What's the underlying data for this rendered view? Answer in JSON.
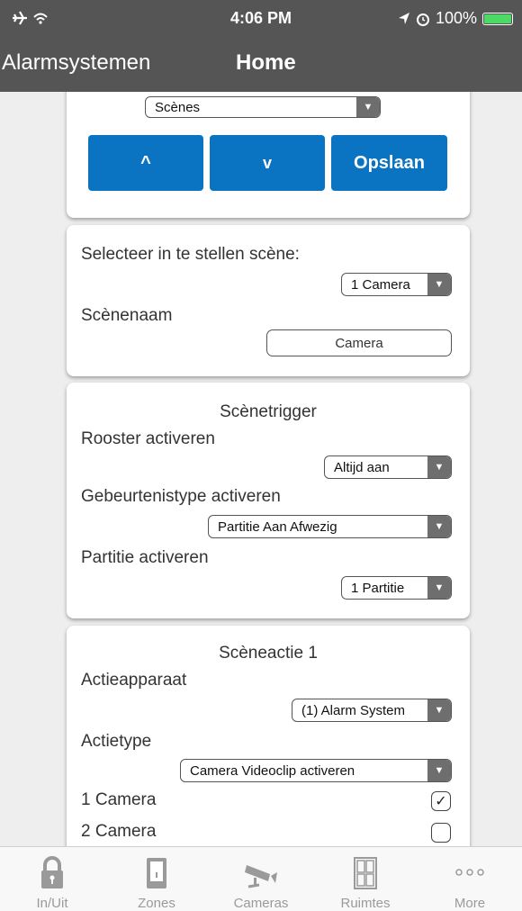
{
  "status_bar": {
    "time": "4:06 PM",
    "battery": "100%",
    "left_icons": "airplane-wifi",
    "right_icons": "location-alarm"
  },
  "nav": {
    "back_label": "Alarmsystemen",
    "title": "Home"
  },
  "top_card": {
    "dropdown_value": "Scènes",
    "up_label": "^",
    "down_label": "v",
    "save_label": "Opslaan"
  },
  "scene_card": {
    "select_label": "Selecteer in te stellen scène:",
    "scene_value": "1 Camera",
    "name_label": "Scènenaam",
    "name_value": "Camera"
  },
  "trigger_card": {
    "title": "Scènetrigger",
    "schedule_label": "Rooster activeren",
    "schedule_value": "Altijd aan",
    "event_label": "Gebeurtenistype activeren",
    "event_value": "Partitie Aan Afwezig",
    "partition_label": "Partitie activeren",
    "partition_value": "1 Partitie"
  },
  "action_card": {
    "title": "Scèneactie 1",
    "device_label": "Actieapparaat",
    "device_value": "(1) Alarm System",
    "type_label": "Actietype",
    "type_value": "Camera Videoclip activeren",
    "cameras": [
      {
        "label": "1 Camera",
        "checked": true
      },
      {
        "label": "2 Camera",
        "checked": false
      }
    ]
  },
  "tabs": [
    {
      "label": "In/Uit",
      "icon": "lock-icon"
    },
    {
      "label": "Zones",
      "icon": "door-icon"
    },
    {
      "label": "Cameras",
      "icon": "camera-icon"
    },
    {
      "label": "Ruimtes",
      "icon": "rooms-icon"
    },
    {
      "label": "More",
      "icon": "more-icon"
    }
  ],
  "colors": {
    "header_bg": "#555555",
    "button_blue": "#0a73c2",
    "tab_inactive": "#9a9a9a",
    "battery_green": "#4cd964"
  }
}
